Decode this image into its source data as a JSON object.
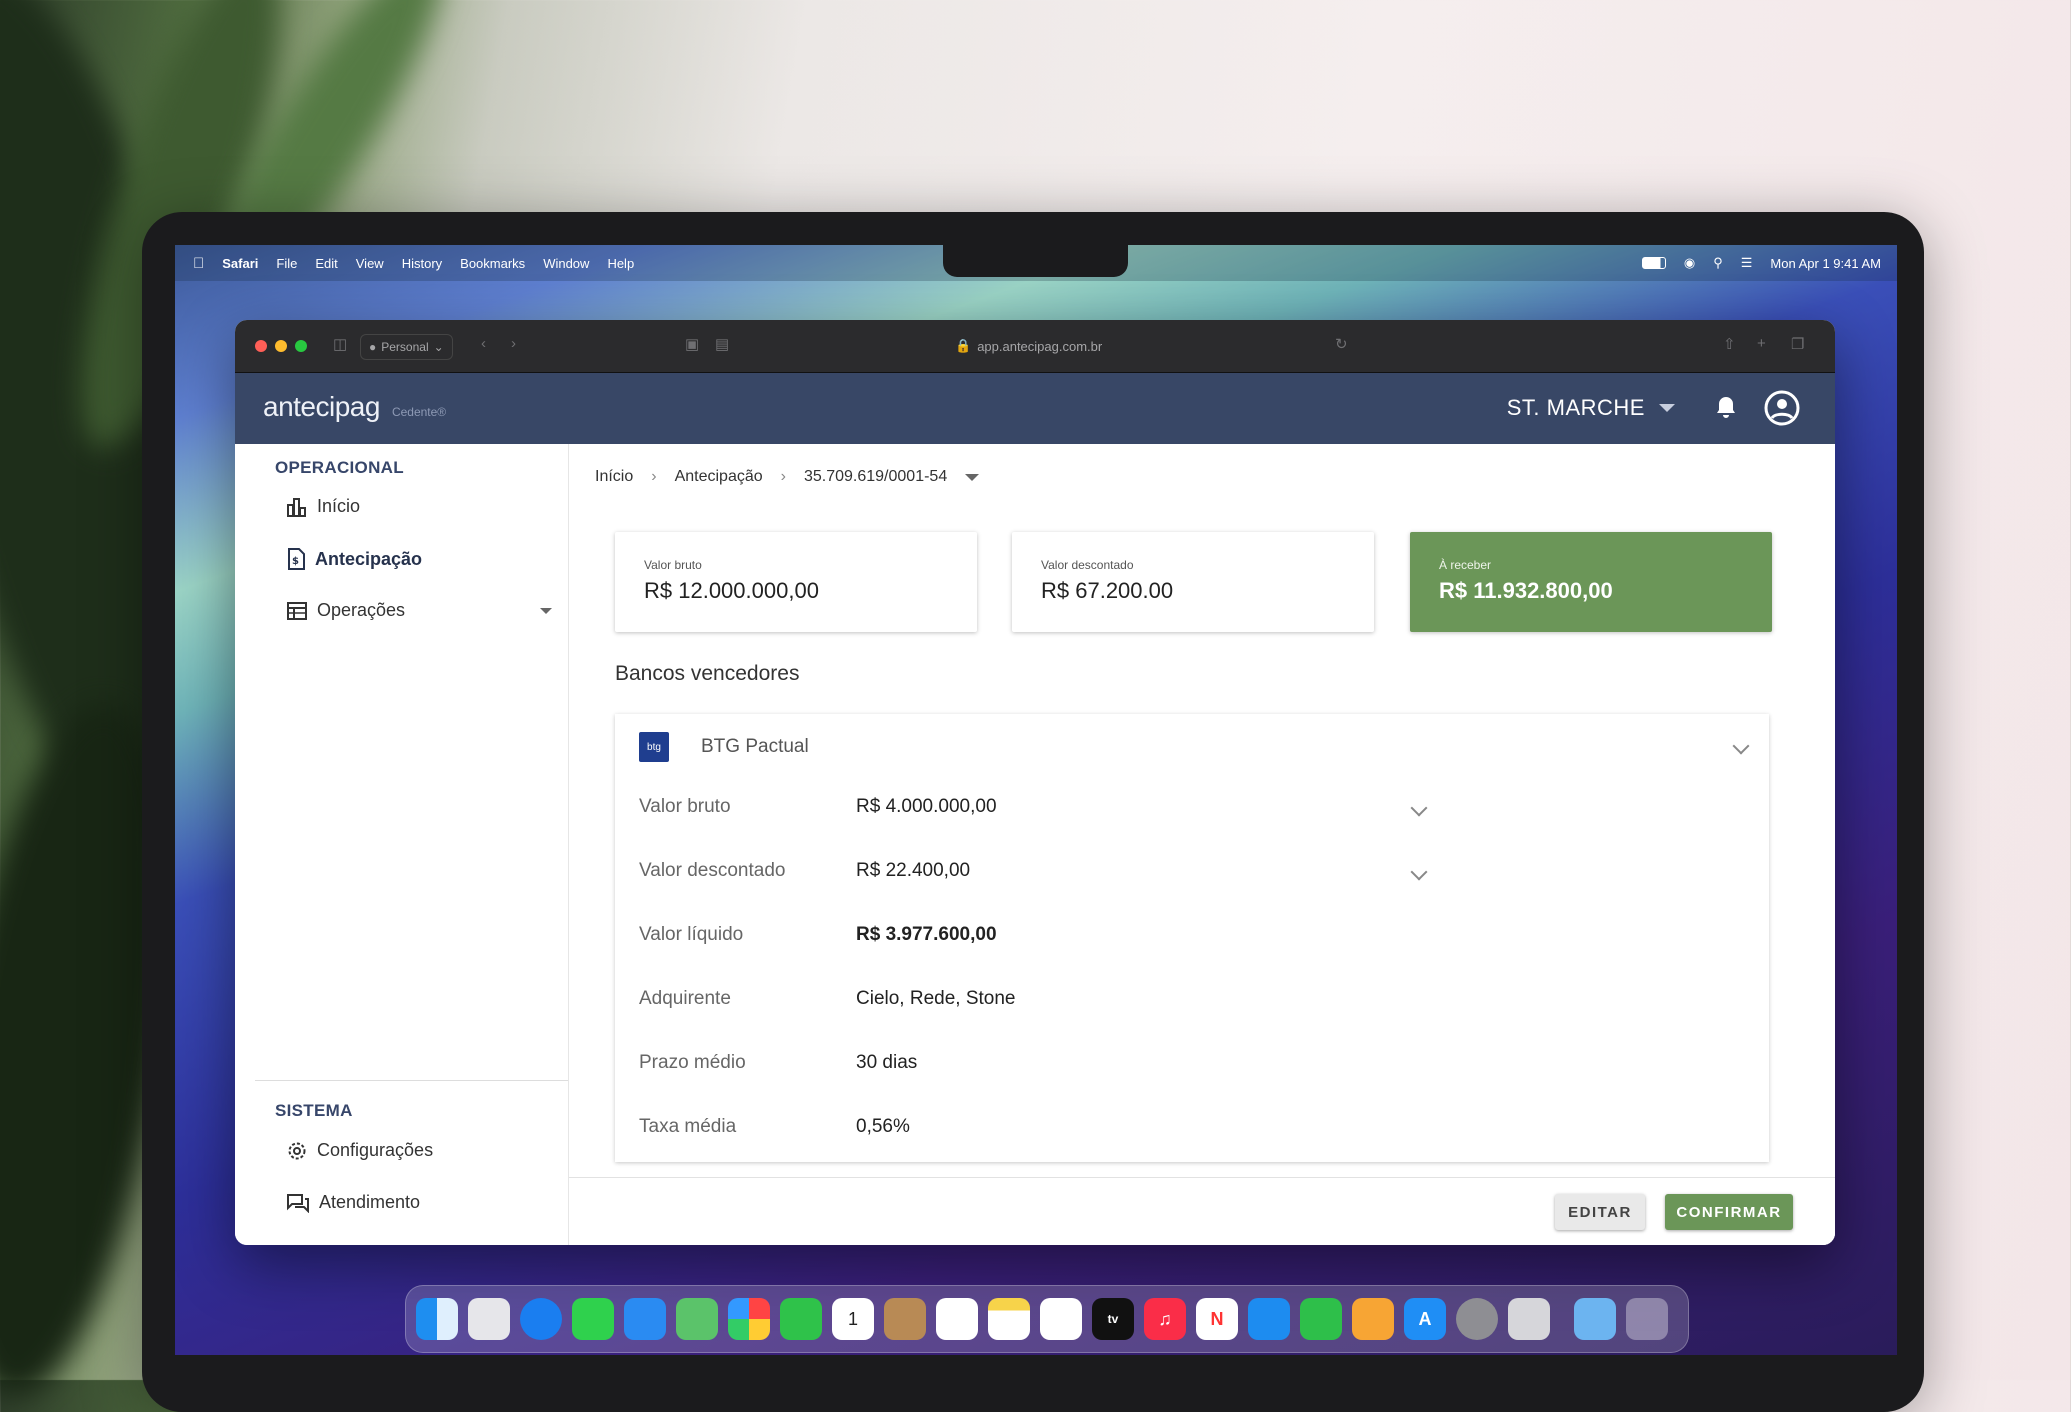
{
  "menubar": {
    "app_name": "Safari",
    "items": [
      "File",
      "Edit",
      "View",
      "History",
      "Bookmarks",
      "Window",
      "Help"
    ],
    "clock": "Mon Apr 1  9:41 AM"
  },
  "browser": {
    "profile": "Personal",
    "url": "app.antecipag.com.br"
  },
  "header": {
    "logo": "antecipag",
    "logo_sub": "Cedente®",
    "company": "ST. MARCHE"
  },
  "sidebar": {
    "operacional_title": "OPERACIONAL",
    "items": [
      {
        "label": "Início",
        "icon": "chart-icon"
      },
      {
        "label": "Antecipação",
        "icon": "document-icon"
      },
      {
        "label": "Operações",
        "icon": "table-icon"
      }
    ],
    "sistema_title": "SISTEMA",
    "system_items": [
      {
        "label": "Configurações",
        "icon": "gear-icon"
      },
      {
        "label": "Atendimento",
        "icon": "chat-icon"
      }
    ]
  },
  "breadcrumb": {
    "home": "Início",
    "section": "Antecipação",
    "cnpj": "35.709.619/0001-54"
  },
  "summary": {
    "bruto_label": "Valor bruto",
    "bruto_value": "R$ 12.000.000,00",
    "desc_label": "Valor descontado",
    "desc_value": "R$ 67.200.00",
    "receber_label": "À receber",
    "receber_value": "R$ 11.932.800,00"
  },
  "banks_title": "Bancos vencedores",
  "bank": {
    "logo_text": "btg",
    "name": "BTG Pactual",
    "rows": [
      {
        "key": "Valor bruto",
        "value": "R$ 4.000.000,00"
      },
      {
        "key": "Valor descontado",
        "value": "R$ 22.400,00"
      },
      {
        "key": "Valor líquido",
        "value": "R$ 3.977.600,00"
      },
      {
        "key": "Adquirente",
        "value": "Cielo, Rede, Stone"
      },
      {
        "key": "Prazo médio",
        "value": "30 dias"
      },
      {
        "key": "Taxa média",
        "value": "0,56%"
      }
    ]
  },
  "actions": {
    "edit": "EDITAR",
    "confirm": "CONFIRMAR"
  },
  "colors": {
    "header_bg": "#384766",
    "accent_green": "#6b9658"
  }
}
